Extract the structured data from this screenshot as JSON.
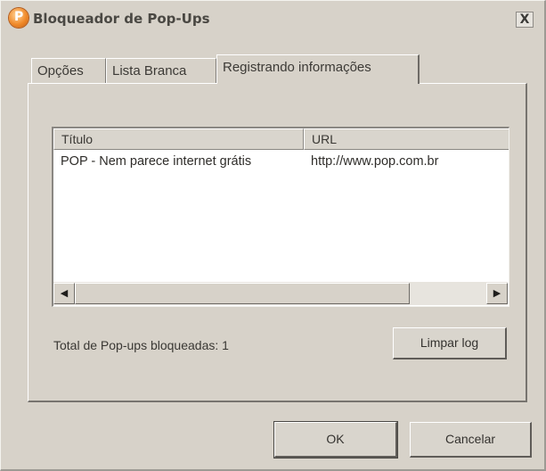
{
  "window": {
    "title": "Bloqueador de Pop-Ups",
    "close_label": "X"
  },
  "tabs": [
    {
      "label": "Opções",
      "active": false
    },
    {
      "label": "Lista Branca",
      "active": false
    },
    {
      "label": "Registrando informações",
      "active": true
    }
  ],
  "log_table": {
    "columns": [
      "Título",
      "URL"
    ],
    "rows": [
      {
        "title": "POP - Nem parece internet grátis",
        "url": "http://www.pop.com.br"
      }
    ]
  },
  "scrollbar": {
    "left_arrow": "◀",
    "right_arrow": "▶"
  },
  "status": {
    "text": "Total de Pop-ups bloqueadas: 1"
  },
  "buttons": {
    "clear_log": "Limpar log",
    "ok": "OK",
    "cancel": "Cancelar"
  },
  "colors": {
    "dialog_bg": "#d7d2c9",
    "list_bg": "#ffffff",
    "text": "#3a3834"
  }
}
